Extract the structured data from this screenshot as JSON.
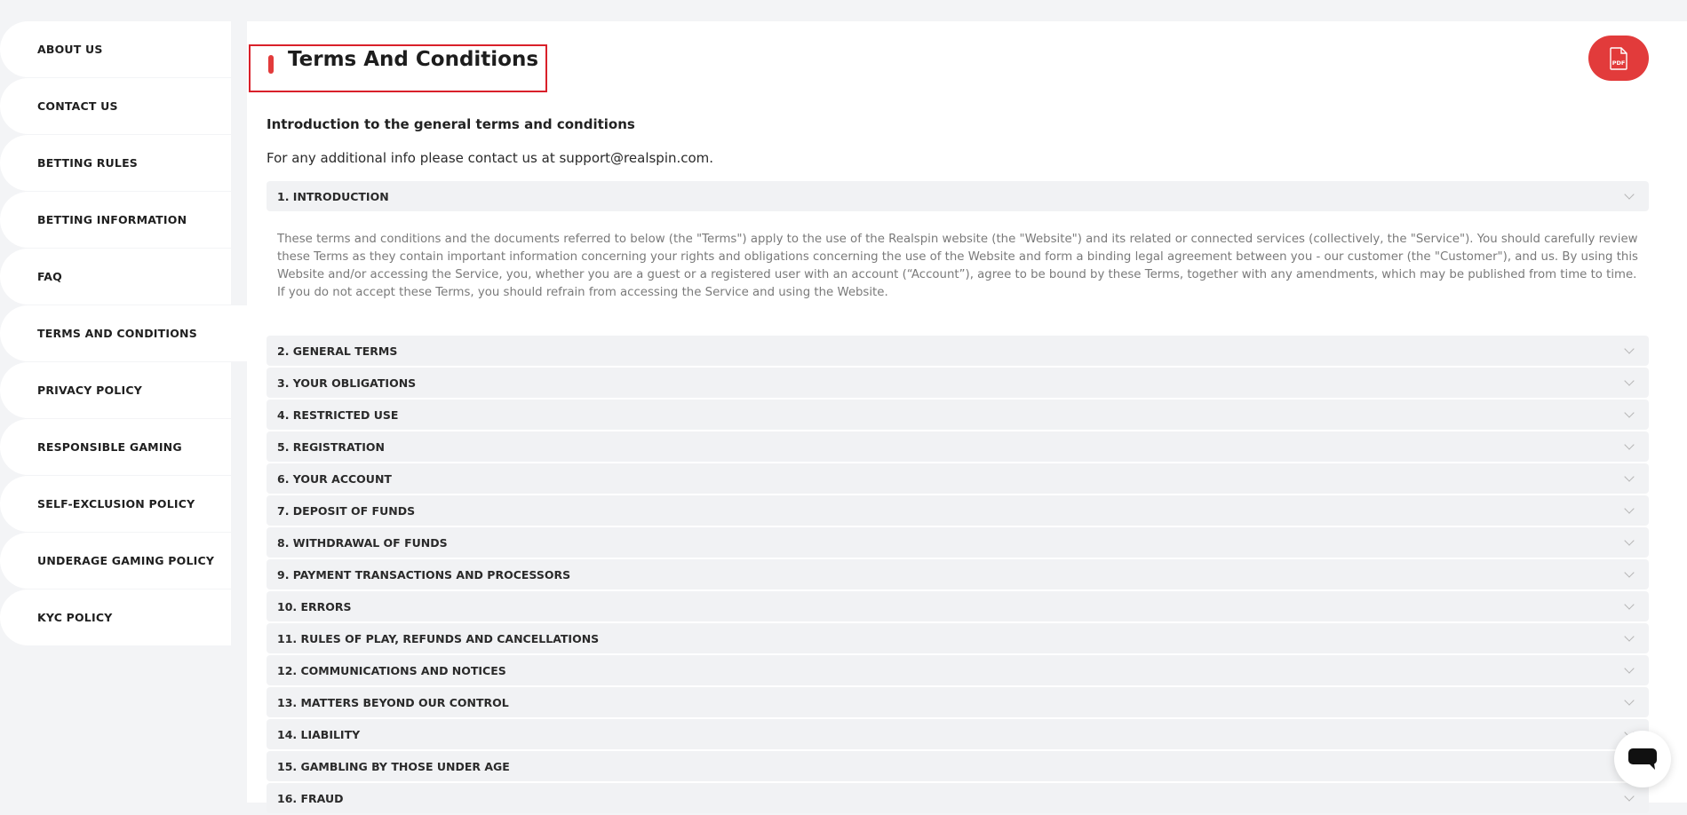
{
  "sidebar": {
    "items": [
      {
        "label": "ABOUT US"
      },
      {
        "label": "CONTACT US"
      },
      {
        "label": "BETTING RULES"
      },
      {
        "label": "BETTING INFORMATION"
      },
      {
        "label": "FAQ"
      },
      {
        "label": "TERMS AND CONDITIONS"
      },
      {
        "label": "PRIVACY POLICY"
      },
      {
        "label": "RESPONSIBLE GAMING"
      },
      {
        "label": "SELF-EXCLUSION POLICY"
      },
      {
        "label": "UNDERAGE GAMING POLICY"
      },
      {
        "label": "KYC POLICY"
      }
    ],
    "active": "TERMS AND CONDITIONS"
  },
  "main": {
    "title": "Terms And Conditions",
    "pdf_icon": "pdf-file-icon",
    "intro_heading": "Introduction to the general terms and conditions",
    "intro_line": "For any additional info please contact us at support@realspin.com.",
    "sections": [
      {
        "title": "1. INTRODUCTION",
        "expanded": true,
        "body": "These terms and conditions and the documents referred to below (the \"Terms\") apply to the use of the Realspin website (the \"Website\") and its related or connected services (collectively, the \"Service\"). You should carefully review these Terms as they contain important information concerning your rights and obligations concerning the use of the Website and form a binding legal agreement between you - our customer (the \"Customer\"), and us. By using this Website and/or accessing the Service, you, whether you are a guest or a registered user with an account (“Account”), agree to be bound by these Terms, together with any amendments, which may be published from time to time. If you do not accept these Terms, you should refrain from accessing the Service and using the Website."
      },
      {
        "title": "2. GENERAL TERMS"
      },
      {
        "title": "3. YOUR OBLIGATIONS"
      },
      {
        "title": "4. RESTRICTED USE"
      },
      {
        "title": "5. REGISTRATION"
      },
      {
        "title": "6. YOUR ACCOUNT"
      },
      {
        "title": "7. DEPOSIT OF FUNDS"
      },
      {
        "title": "8. WITHDRAWAL OF FUNDS"
      },
      {
        "title": "9. PAYMENT TRANSACTIONS AND PROCESSORS"
      },
      {
        "title": "10. ERRORS"
      },
      {
        "title": "11. RULES OF PLAY, REFUNDS AND CANCELLATIONS"
      },
      {
        "title": "12. COMMUNICATIONS AND NOTICES"
      },
      {
        "title": "13. MATTERS BEYOND OUR CONTROL"
      },
      {
        "title": "14. LIABILITY"
      },
      {
        "title": "15. GAMBLING BY THOSE UNDER AGE"
      },
      {
        "title": "16. FRAUD"
      }
    ]
  },
  "chat": {
    "icon": "chat-bubble-icon"
  },
  "colors": {
    "accent": "#e23b3b",
    "highlight_box": "#d9202a",
    "background": "#f3f4f6",
    "panel": "#ffffff"
  }
}
